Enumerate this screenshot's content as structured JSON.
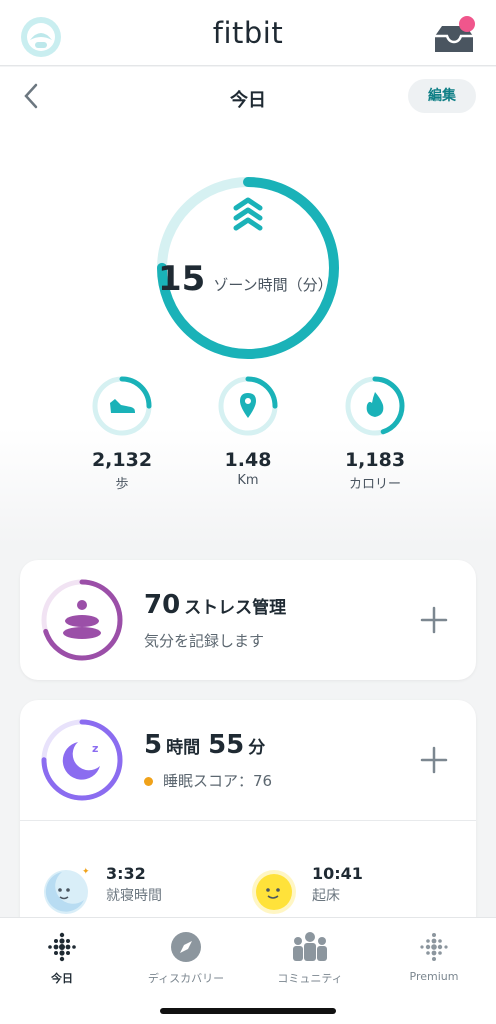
{
  "header": {
    "brand": "fitbit"
  },
  "subheader": {
    "title": "今日",
    "edit_label": "編集"
  },
  "zone": {
    "value": "15",
    "label": "ゾーン時間（分）",
    "progress": 0.75
  },
  "stats": [
    {
      "value": "2,132",
      "unit": "歩",
      "icon": "shoe-icon",
      "progress": 0.25
    },
    {
      "value": "1.48",
      "unit": "Km",
      "icon": "location-pin-icon",
      "progress": 0.25
    },
    {
      "value": "1,183",
      "unit": "カロリー",
      "icon": "flame-icon",
      "progress": 0.45
    }
  ],
  "stress": {
    "value": "70",
    "title": "ストレス管理",
    "subtitle": "気分を記録します",
    "progress": 0.7
  },
  "sleep": {
    "hours": "5",
    "hours_unit": "時間",
    "minutes": "55",
    "minutes_unit": "分",
    "score_label": "睡眠スコア：76",
    "progress": 0.75,
    "bedtime": {
      "time": "3:32",
      "label": "就寝時間"
    },
    "wake": {
      "time": "10:41",
      "label": "起床"
    }
  },
  "tabs": [
    {
      "label": "今日",
      "icon": "today-dots-icon",
      "active": true
    },
    {
      "label": "ディスカバリー",
      "icon": "compass-icon",
      "active": false
    },
    {
      "label": "コミュニティ",
      "icon": "community-icon",
      "active": false
    },
    {
      "label": "Premium",
      "icon": "premium-dots-icon",
      "active": false
    }
  ],
  "colors": {
    "teal": "#1ab2b8",
    "teal_light": "#d6f1f2",
    "purple": "#9b4fa8",
    "sleep_purple": "#8b6cf0",
    "badge_pink": "#f0568c"
  }
}
